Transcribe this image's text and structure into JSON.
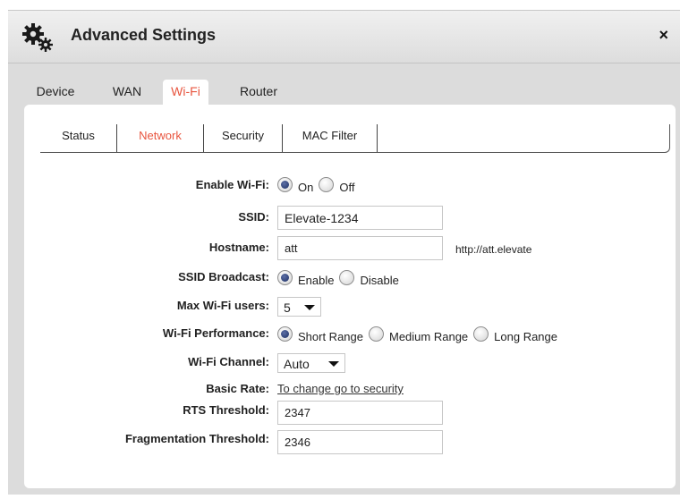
{
  "window": {
    "title": "Advanced Settings",
    "close_glyph": "×"
  },
  "main_tabs": [
    {
      "label": "Device",
      "active": false
    },
    {
      "label": "WAN",
      "active": false
    },
    {
      "label": "Wi-Fi",
      "active": true
    },
    {
      "label": "Router",
      "active": false
    }
  ],
  "sub_tabs": [
    {
      "label": "Status",
      "active": false
    },
    {
      "label": "Network",
      "active": true
    },
    {
      "label": "Security",
      "active": false
    },
    {
      "label": "MAC Filter",
      "active": false
    }
  ],
  "form": {
    "enable_wifi": {
      "label": "Enable Wi-Fi:",
      "options": [
        "On",
        "Off"
      ],
      "selected": "On"
    },
    "ssid": {
      "label": "SSID:",
      "value": "Elevate-1234"
    },
    "hostname": {
      "label": "Hostname:",
      "value": "att",
      "suffix": "http://att.elevate"
    },
    "ssid_broadcast": {
      "label": "SSID Broadcast:",
      "options": [
        "Enable",
        "Disable"
      ],
      "selected": "Enable"
    },
    "max_users": {
      "label": "Max Wi-Fi users:",
      "value": "5"
    },
    "performance": {
      "label": "Wi-Fi Performance:",
      "options": [
        "Short Range",
        "Medium Range",
        "Long Range"
      ],
      "selected": "Short Range"
    },
    "channel": {
      "label": "Wi-Fi Channel:",
      "value": "Auto"
    },
    "basic_rate": {
      "label": "Basic Rate:",
      "link": "To change go to security"
    },
    "rts": {
      "label": "RTS Threshold:",
      "value": "2347"
    },
    "fragmentation": {
      "label": "Fragmentation Threshold:",
      "value": "2346"
    }
  }
}
